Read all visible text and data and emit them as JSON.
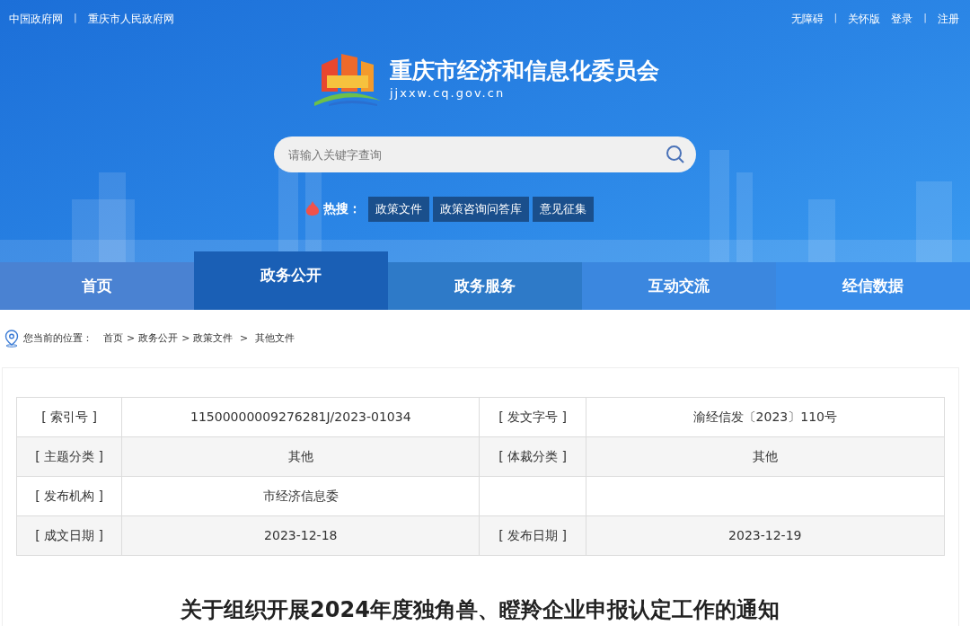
{
  "top_bar": {
    "left": [
      {
        "kind": "link",
        "text": "中国政府网"
      },
      {
        "kind": "divider",
        "text": "|"
      },
      {
        "kind": "link",
        "text": "重庆市人民政府网"
      }
    ],
    "right": [
      {
        "kind": "link",
        "text": "无障碍"
      },
      {
        "kind": "divider",
        "text": "|"
      },
      {
        "kind": "link",
        "text": "关怀版"
      },
      {
        "kind": "link",
        "text": "登录"
      },
      {
        "kind": "divider",
        "text": "|"
      },
      {
        "kind": "link",
        "text": "注册"
      }
    ]
  },
  "site": {
    "title": "重庆市经济和信息化委员会",
    "domain": "jjxxw.cq.gov.cn"
  },
  "search": {
    "placeholder": "请输入关键字查询"
  },
  "hot_search": {
    "label": "热搜：",
    "tags": [
      "政策文件",
      "政策咨询问答库",
      "意见征集"
    ]
  },
  "nav": [
    {
      "label": "首页",
      "selected": false
    },
    {
      "label": "政务公开",
      "selected": true
    },
    {
      "label": "政务服务",
      "selected": false
    },
    {
      "label": "互动交流",
      "selected": false
    },
    {
      "label": "经信数据",
      "selected": false
    }
  ],
  "breadcrumb": {
    "label": "您当前的位置：",
    "items": [
      {
        "text": "首页"
      },
      {
        "kind": "sep",
        "text": ">"
      },
      {
        "text": "政务公开"
      },
      {
        "kind": "sep",
        "text": ">"
      },
      {
        "text": "政策文件"
      },
      {
        "kind": "sep",
        "text": " > "
      },
      {
        "text": "其他文件"
      }
    ]
  },
  "info_table": {
    "rows": [
      [
        "[ 索引号 ]",
        "11500000009276281J/2023-01034",
        "[ 发文字号 ]",
        "渝经信发〔2023〕110号"
      ],
      [
        "[ 主题分类 ]",
        "其他",
        "[ 体裁分类 ]",
        "其他"
      ],
      [
        "[ 发布机构 ]",
        "市经济信息委",
        "",
        ""
      ],
      [
        "[ 成文日期 ]",
        "2023-12-18",
        "[ 发布日期 ]",
        "2023-12-19"
      ]
    ]
  },
  "article": {
    "title": "关于组织开展2024年度独角兽、瞪羚企业申报认定工作的通知"
  }
}
